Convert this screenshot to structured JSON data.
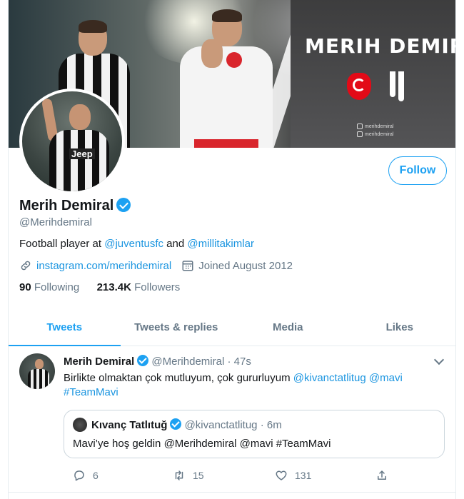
{
  "banner": {
    "name_text": "MERIH DEMIRAL",
    "social_instagram": "merihdemiral",
    "social_facebook": "merihdemiral",
    "avatar_jersey_text": "Jeep"
  },
  "profile": {
    "follow_label": "Follow",
    "display_name": "Merih Demiral",
    "handle": "@Merihdemiral",
    "bio_prefix": "Football player at ",
    "bio_link1": "@juventusfc",
    "bio_mid": " and ",
    "bio_link2": "@millitakimlar",
    "website": "instagram.com/merihdemiral",
    "joined": "Joined August 2012",
    "following_count": "90",
    "following_label": "Following",
    "followers_count": "213.4K",
    "followers_label": "Followers"
  },
  "tabs": [
    {
      "label": "Tweets",
      "active": true
    },
    {
      "label": "Tweets & replies",
      "active": false
    },
    {
      "label": "Media",
      "active": false
    },
    {
      "label": "Likes",
      "active": false
    }
  ],
  "tweet": {
    "author": "Merih Demiral",
    "handle": "@Merihdemiral",
    "separator": "·",
    "time": "47s",
    "text_plain": "Birlikte olmaktan çok mutluyum, çok gururluyum ",
    "mention1": "@kivanctatlitug",
    "mention2": "@mavi",
    "hashtag": "#TeamMavi",
    "quote": {
      "author": "Kıvanç Tatlıtuğ",
      "handle": "@kivanctatlitug",
      "time": "6m",
      "text": "Mavi’ye hoş geldin @Merihdemiral @mavi #TeamMavi"
    },
    "replies": "6",
    "retweets": "15",
    "likes": "131"
  },
  "colors": {
    "accent": "#1da1f2",
    "link": "#1b95e0",
    "muted": "#657786"
  }
}
